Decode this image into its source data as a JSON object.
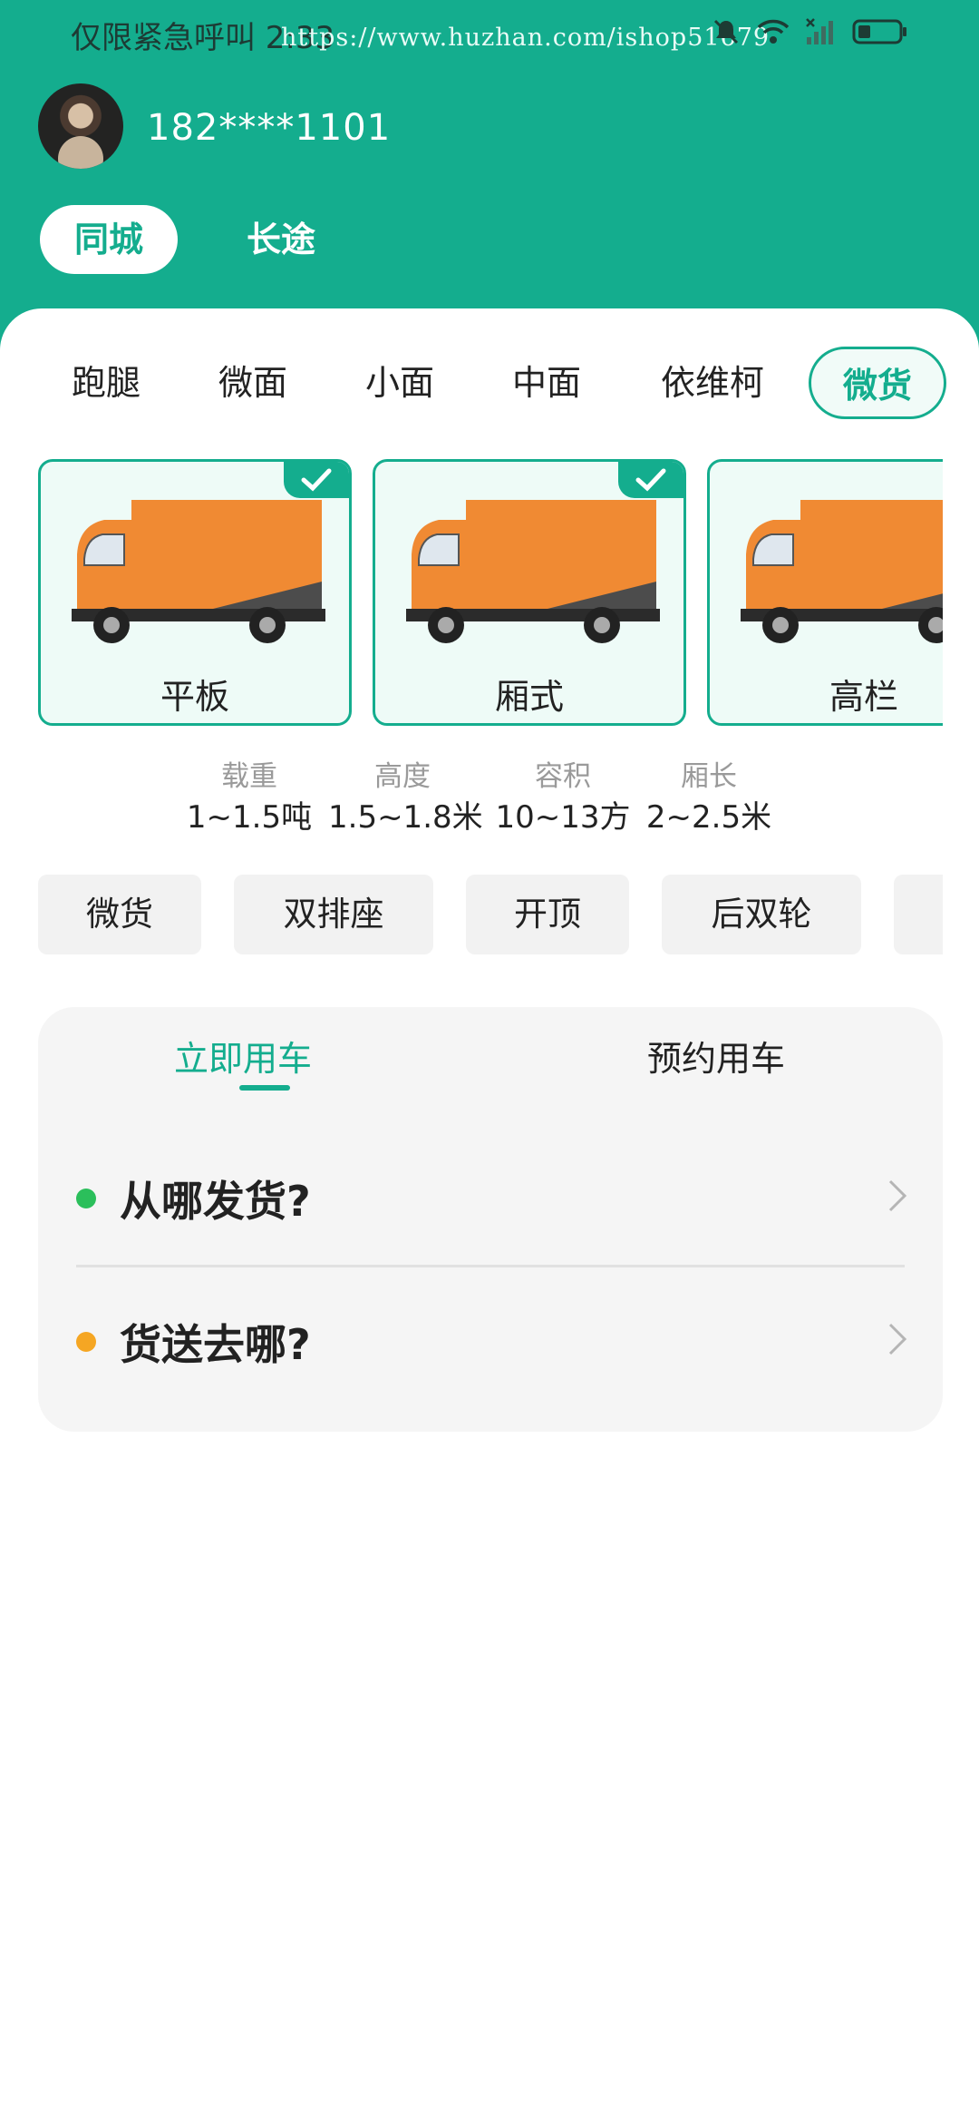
{
  "status_bar": {
    "left_text": "仅限紧急呼叫 2:33",
    "watermark": "https://www.huzhan.com/ishop51679",
    "icons": [
      "bell-muted-icon",
      "wifi-icon",
      "signal-icon",
      "battery-icon"
    ]
  },
  "user": {
    "phone": "182****1101"
  },
  "mode_tabs": [
    {
      "label": "同城",
      "active": true
    },
    {
      "label": "长途",
      "active": false
    }
  ],
  "categories": [
    {
      "label": "跑腿",
      "active": false
    },
    {
      "label": "微面",
      "active": false
    },
    {
      "label": "小面",
      "active": false
    },
    {
      "label": "中面",
      "active": false
    },
    {
      "label": "依维柯",
      "active": false
    },
    {
      "label": "微货",
      "active": true
    }
  ],
  "truck_types": [
    {
      "label": "平板",
      "selected": true
    },
    {
      "label": "厢式",
      "selected": true
    },
    {
      "label": "高栏",
      "selected": false
    }
  ],
  "specs": [
    {
      "label": "载重",
      "value": "1~1.5吨"
    },
    {
      "label": "高度",
      "value": "1.5~1.8米"
    },
    {
      "label": "容积",
      "value": "10~13方"
    },
    {
      "label": "厢长",
      "value": "2~2.5米"
    }
  ],
  "features": [
    "微货",
    "双排座",
    "开顶",
    "后双轮",
    ""
  ],
  "order": {
    "tabs": [
      {
        "label": "立即用车",
        "active": true
      },
      {
        "label": "预约用车",
        "active": false
      }
    ],
    "from_label": "从哪发货?",
    "to_label": "货送去哪?"
  },
  "colors": {
    "accent": "#14ad8e",
    "from_dot": "#2bbf5b",
    "to_dot": "#f5a623",
    "truck_orange": "#f08a33"
  }
}
